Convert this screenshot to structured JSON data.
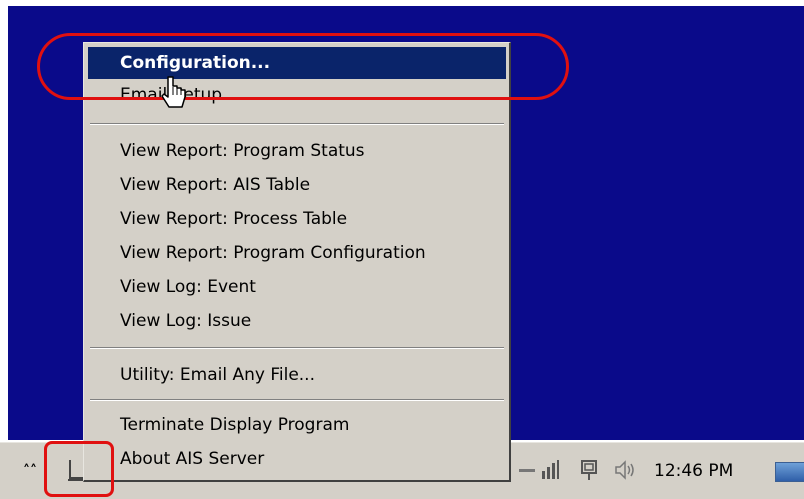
{
  "menu": {
    "items": [
      {
        "label": "Configuration...",
        "active": true
      },
      {
        "label": "Email Setup...",
        "active": false
      },
      {
        "label": "View Report: Program Status",
        "active": false
      },
      {
        "label": "View Report: AIS Table",
        "active": false
      },
      {
        "label": "View Report: Process Table",
        "active": false
      },
      {
        "label": "View Report: Program Configuration",
        "active": false
      },
      {
        "label": "View Log: Event",
        "active": false
      },
      {
        "label": "View Log: Issue",
        "active": false
      },
      {
        "label": "Utility: Email Any File...",
        "active": false
      },
      {
        "label": "Terminate Display Program",
        "active": false
      },
      {
        "label": "About AIS Server",
        "active": false
      }
    ]
  },
  "taskbar": {
    "expand_glyph": "»",
    "clock": "12:46 PM",
    "tray_icons": [
      "ais-server-icon",
      "network-icon",
      "power-icon",
      "volume-icon"
    ]
  },
  "colors": {
    "desktop": "#0a0a8a",
    "menu_bg": "#d4d0c8",
    "highlight": "#0a246a",
    "annotation": "#e01010"
  }
}
